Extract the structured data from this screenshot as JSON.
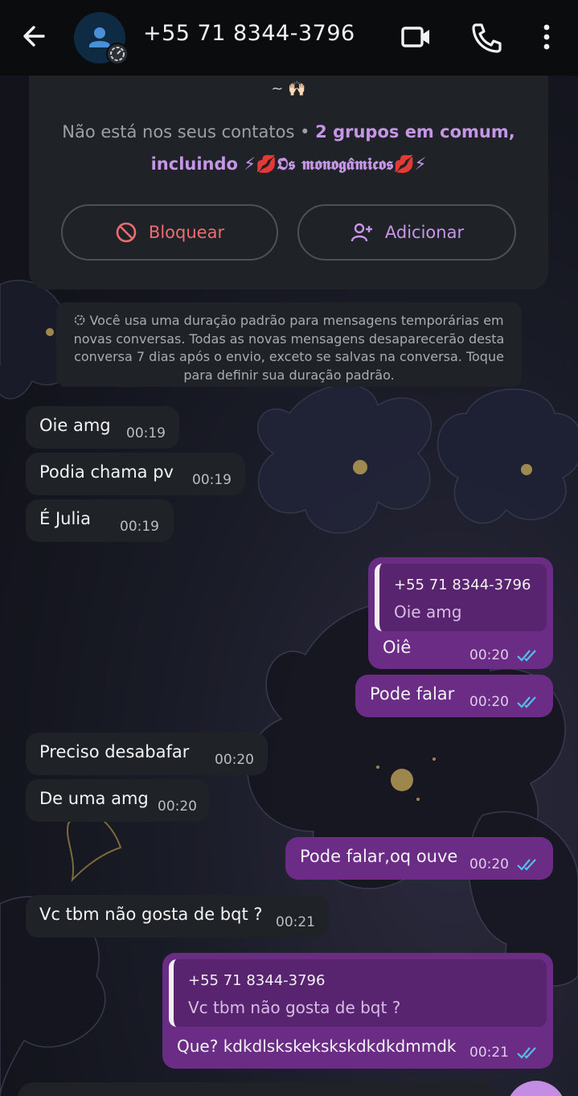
{
  "header": {
    "title": "+55 71 8344-3796",
    "icons": [
      "back-arrow-icon",
      "person-icon",
      "timer-icon",
      "video-call-icon",
      "phone-icon",
      "more-vert-icon"
    ]
  },
  "info_card": {
    "emoji_line": "~ 🙌🏻",
    "note_prefix": "Não está nos seus contatos • ",
    "note_highlight": "2 grupos em comum,",
    "note_line2_prefix": "incluindo ",
    "group_name": "⚡💋𝕺𝖘 𝖒𝖔𝖓𝖔𝖌𝖆̂𝖒𝖎𝖈𝖔𝖘💋⚡",
    "block_label": "Bloquear",
    "add_label": "Adicionar"
  },
  "notice": {
    "text": "Você usa uma duração padrão para mensagens temporárias em novas conversas. Todas as novas mensagens desaparecerão desta conversa 7 dias após o envio, exceto se salvas na conversa. Toque para definir sua duração padrão."
  },
  "messages": [
    {
      "dir": "in",
      "text": "Oie amg",
      "time": "00:19"
    },
    {
      "dir": "in",
      "text": "Podia chama pv",
      "time": "00:19"
    },
    {
      "dir": "in",
      "text": "É Julia",
      "time": "00:19"
    },
    {
      "dir": "out",
      "quote_author": "+55 71 8344-3796",
      "quote_text": "Oie amg",
      "text": "Oiê",
      "time": "00:20"
    },
    {
      "dir": "out",
      "text": "Pode falar",
      "time": "00:20"
    },
    {
      "dir": "in",
      "text": "Preciso desabafar",
      "time": "00:20"
    },
    {
      "dir": "in",
      "text": "De uma amg",
      "time": "00:20"
    },
    {
      "dir": "out",
      "text": "Pode falar,oq ouve",
      "time": "00:20"
    },
    {
      "dir": "in",
      "text": "Vc tbm não gosta de bqt ?",
      "time": "00:21"
    },
    {
      "dir": "out",
      "quote_author": "+55 71 8344-3796",
      "quote_text": "Vc tbm não gosta de bqt ?",
      "text": "Que? kdkdlskskeksksk­dkdkdmmdk",
      "time": "00:21"
    }
  ],
  "colors": {
    "incoming_bubble": "#1f2327",
    "outgoing_bubble": "#6b2c86",
    "accent_purple": "#c795e8",
    "block_red": "#ef6b6f",
    "read_ticks": "#53bdeb"
  }
}
